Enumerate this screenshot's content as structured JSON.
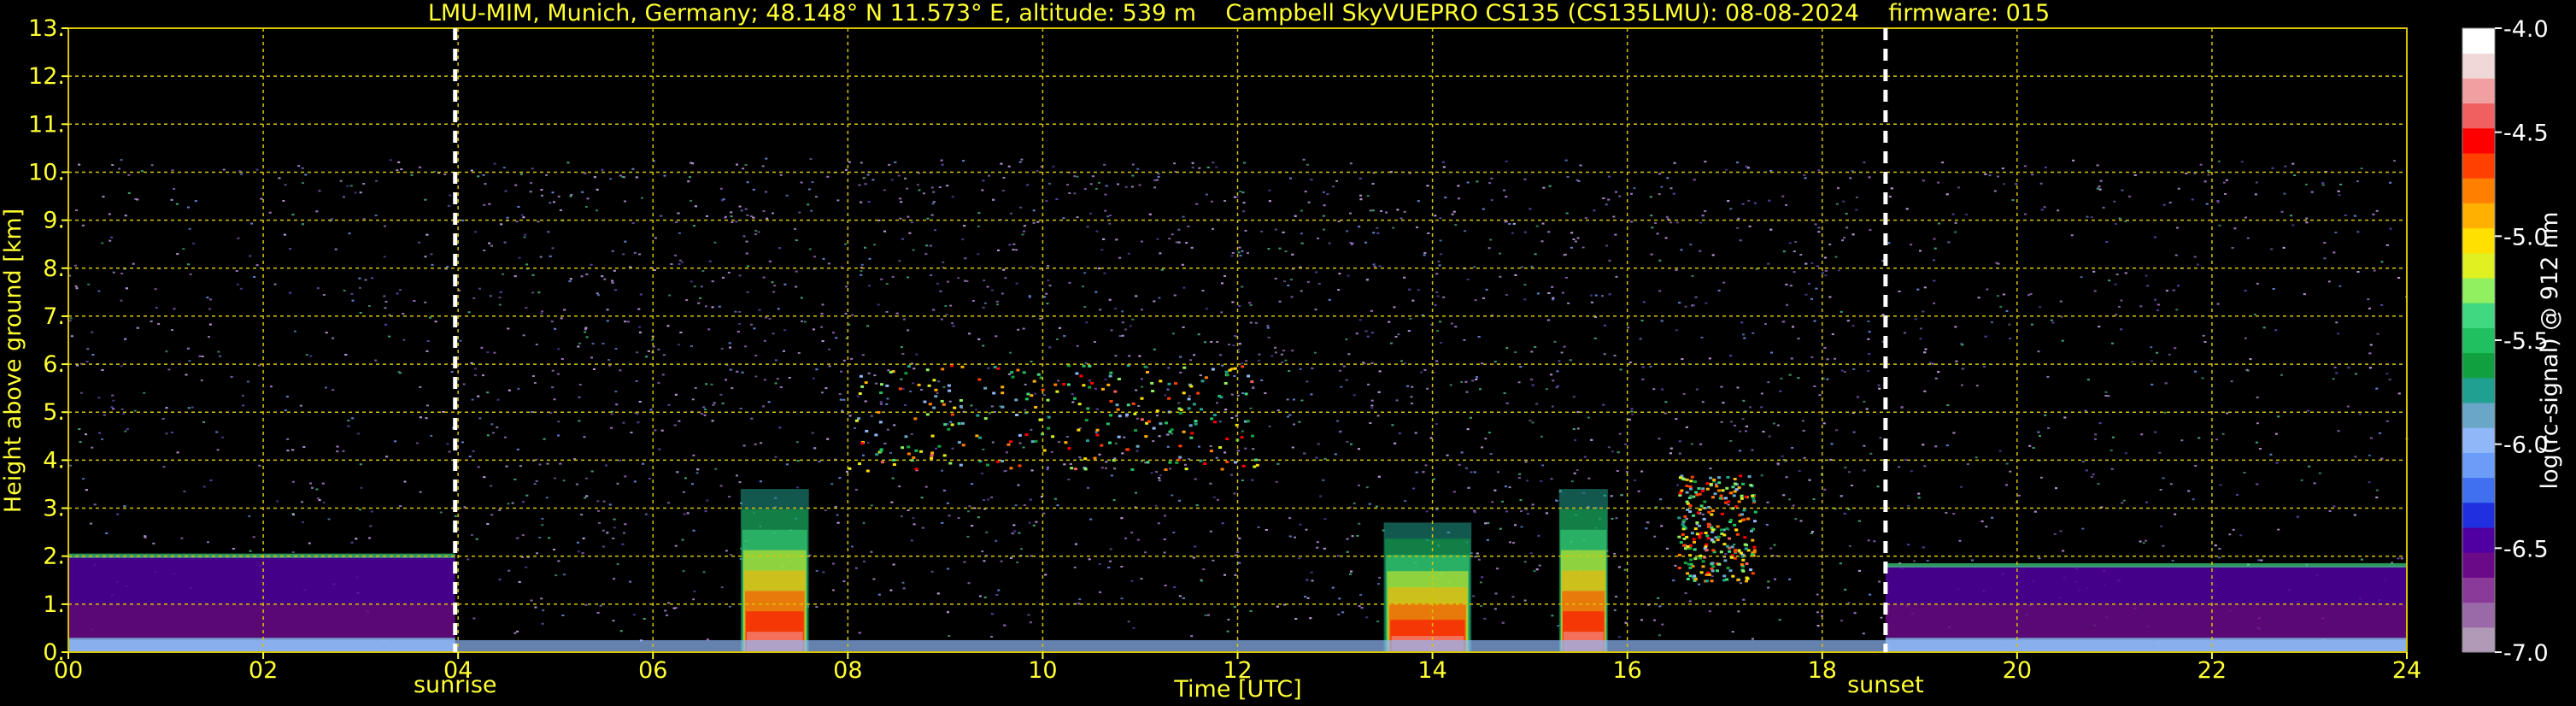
{
  "chart_data": {
    "type": "heatmap",
    "title": "LMU-MIM, Munich, Germany; 48.148° N 11.573° E, altitude: 539 m    Campbell SkyVUEPRO CS135 (CS135LMU): 08-08-2024    firmware: 015",
    "xlabel": "Time [UTC]",
    "ylabel": "Height above ground [km]",
    "xlim": [
      0,
      24
    ],
    "ylim": [
      0,
      13
    ],
    "x_ticks": [
      "00",
      "02",
      "04",
      "06",
      "08",
      "10",
      "12",
      "14",
      "16",
      "18",
      "20",
      "22",
      "24"
    ],
    "x_tick_values": [
      0,
      2,
      4,
      6,
      8,
      10,
      12,
      14,
      16,
      18,
      20,
      22,
      24
    ],
    "y_ticks": [
      "0.",
      "1.",
      "2.",
      "3.",
      "4.",
      "5.",
      "6.",
      "7.",
      "8.",
      "9.",
      "10.",
      "11.",
      "12.",
      "13."
    ],
    "y_tick_values": [
      0,
      1,
      2,
      3,
      4,
      5,
      6,
      7,
      8,
      9,
      10,
      11,
      12,
      13
    ],
    "grid": true,
    "signal_top_km": 10.3,
    "events": [
      {
        "label": "sunrise",
        "time_utc": 3.97
      },
      {
        "label": "sunset",
        "time_utc": 18.65
      }
    ],
    "features": [
      {
        "kind": "boundary-layer",
        "t_start": 0,
        "t_end": 3.97,
        "h_top_km": 2.0
      },
      {
        "kind": "boundary-layer",
        "t_start": 18.65,
        "t_end": 24,
        "h_top_km": 1.8
      },
      {
        "kind": "rain-shaft",
        "t_start": 6.9,
        "t_end": 7.6,
        "h_top_km": 3.4
      },
      {
        "kind": "cloud-base",
        "t_start": 13.5,
        "t_end": 14.4,
        "h_top_km": 2.7
      },
      {
        "kind": "cloud-base",
        "t_start": 15.3,
        "t_end": 15.8,
        "h_top_km": 3.4
      },
      {
        "kind": "elevated-layer",
        "t_start": 8.0,
        "t_end": 12.2,
        "h_top_km": 6.0
      },
      {
        "kind": "elevated-layer",
        "t_start": 16.5,
        "t_end": 17.3,
        "h_top_km": 3.7
      }
    ],
    "colorbar": {
      "label": "log(rc-signal) @ 912 nm",
      "min": -7.0,
      "max": -4.0,
      "ticks": [
        "-4.0",
        "-4.5",
        "-5.0",
        "-5.5",
        "-6.0",
        "-6.5",
        "-7.0"
      ],
      "tick_values": [
        -4.0,
        -4.5,
        -5.0,
        -5.5,
        -6.0,
        -6.5,
        -7.0
      ],
      "colors": [
        "#b09ab8",
        "#9a6aa8",
        "#8a3a98",
        "#6a0a88",
        "#5000a0",
        "#2030e0",
        "#4070f0",
        "#6a9cf8",
        "#90b8f8",
        "#6aa6c8",
        "#20a090",
        "#10a040",
        "#20c060",
        "#40d880",
        "#90f060",
        "#e0f020",
        "#ffe000",
        "#ffb000",
        "#ff8000",
        "#ff4000",
        "#ff0000",
        "#f06060",
        "#f0a0a0",
        "#f0d8d8",
        "#ffffff"
      ]
    }
  }
}
